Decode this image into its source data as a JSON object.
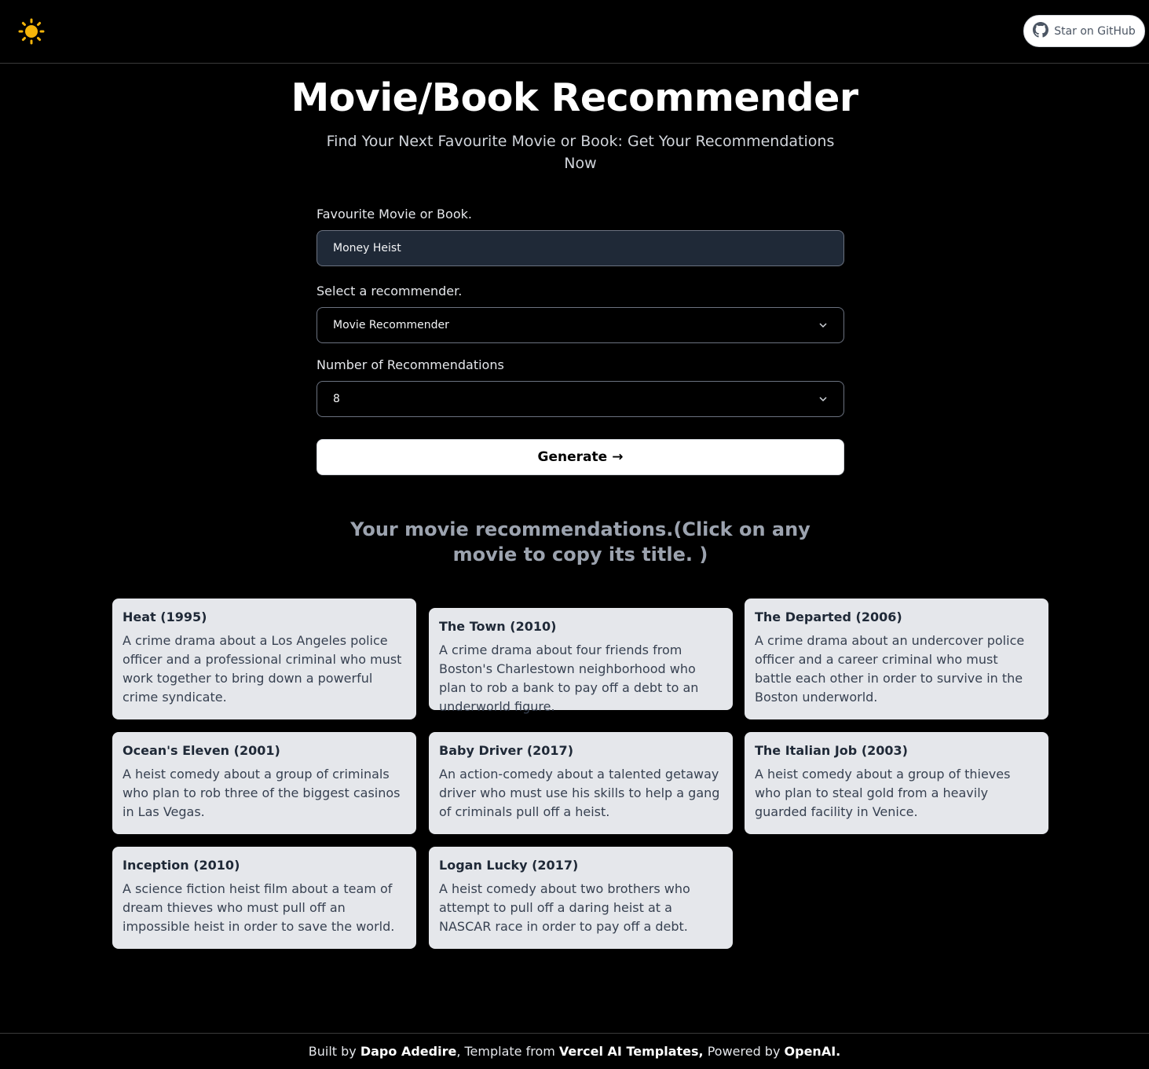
{
  "header": {
    "theme_icon": "sun-icon",
    "github_label": "Star on GitHub",
    "github_icon": "github-icon"
  },
  "hero": {
    "title": "Movie/Book Recommender",
    "subtitle": "Find Your Next Favourite Movie or Book: Get Your Recommendations Now"
  },
  "form": {
    "favourite_label": "Favourite Movie or Book.",
    "favourite_value": "Money Heist",
    "recommender_label": "Select a recommender.",
    "recommender_value": "Movie Recommender",
    "count_label": "Number of Recommendations",
    "count_value": "8",
    "generate_label": "Generate",
    "generate_arrow": "→"
  },
  "results": {
    "heading": "Your movie recommendations.(Click on any movie to copy its title. )",
    "items": [
      {
        "title": "Heat (1995)",
        "description": "A crime drama about a Los Angeles police officer and a professional criminal who must work together to bring down a powerful crime syndicate."
      },
      {
        "title": "The Town (2010)",
        "description": "A crime drama about four friends from Boston's Charlestown neighborhood who plan to rob a bank to pay off a debt to an underworld figure."
      },
      {
        "title": "The Departed (2006)",
        "description": "A crime drama about an undercover police officer and a career criminal who must battle each other in order to survive in the Boston underworld."
      },
      {
        "title": "Ocean's Eleven (2001)",
        "description": "A heist comedy about a group of criminals who plan to rob three of the biggest casinos in Las Vegas."
      },
      {
        "title": "Baby Driver (2017)",
        "description": "An action-comedy about a talented getaway driver who must use his skills to help a gang of criminals pull off a heist."
      },
      {
        "title": "The Italian Job (2003)",
        "description": "A heist comedy about a group of thieves who plan to steal gold from a heavily guarded facility in Venice."
      },
      {
        "title": "Inception (2010)",
        "description": "A science fiction heist film about a team of dream thieves who must pull off an impossible heist in order to save the world."
      },
      {
        "title": "Logan Lucky (2017)",
        "description": "A heist comedy about two brothers who attempt to pull off a daring heist at a NASCAR race in order to pay off a debt."
      }
    ]
  },
  "footer": {
    "built_by": "Built by ",
    "author": "Dapo Adedire",
    "template_from": ", Template from ",
    "template": "Vercel AI Templates,",
    "powered_by": " Powered by ",
    "provider": "OpenAI."
  },
  "colors": {
    "background": "#000000",
    "card": "#e5e7eb",
    "input_bg": "#1f2937",
    "sun": "#f5b50a"
  }
}
